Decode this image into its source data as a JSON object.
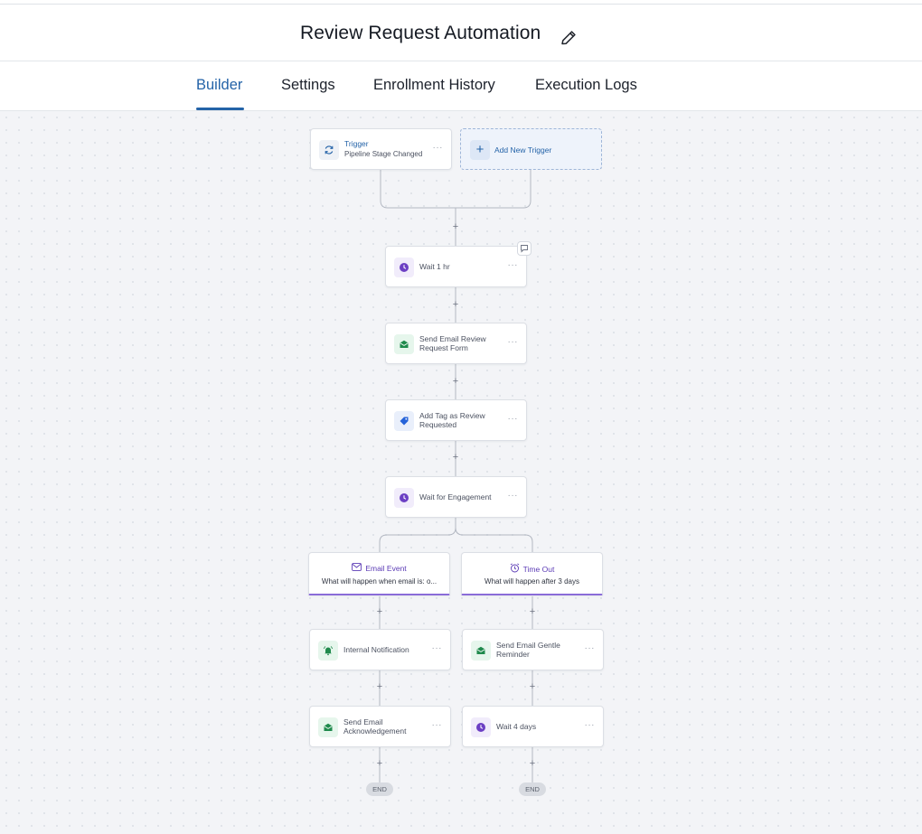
{
  "header": {
    "title": "Review Request Automation"
  },
  "tabs": [
    {
      "label": "Builder",
      "active": true
    },
    {
      "label": "Settings",
      "active": false
    },
    {
      "label": "Enrollment History",
      "active": false
    },
    {
      "label": "Execution Logs",
      "active": false
    }
  ],
  "trigger": {
    "title": "Trigger",
    "subtitle": "Pipeline Stage Changed",
    "icon": "refresh-icon"
  },
  "add_trigger": {
    "label": "Add New Trigger"
  },
  "steps": [
    {
      "label": "Wait 1 hr",
      "icon": "clock-icon"
    },
    {
      "label": "Send Email Review Request Form",
      "icon": "email-icon"
    },
    {
      "label": "Add Tag as Review Requested",
      "icon": "tag-icon"
    },
    {
      "label": "Wait for Engagement",
      "icon": "clock-icon"
    }
  ],
  "branches": [
    {
      "title": "Email Event",
      "subtitle": "What will happen when email is: o...",
      "icon": "envelope-icon"
    },
    {
      "title": "Time Out",
      "subtitle": "What will happen after 3 days",
      "icon": "alarm-icon"
    }
  ],
  "left_steps": [
    {
      "label": "Internal Notification",
      "icon": "bell-icon"
    },
    {
      "label": "Send Email Acknowledgement",
      "icon": "email-icon"
    }
  ],
  "right_steps": [
    {
      "label": "Send Email Gentle Reminder",
      "icon": "email-icon"
    },
    {
      "label": "Wait 4 days",
      "icon": "clock-icon"
    }
  ],
  "end_label": "END",
  "menu_glyph": "···",
  "plus_glyph": "+",
  "colors": {
    "accent": "#2463a8",
    "branch_accent": "#8a6cd8",
    "wait": "#6c3fc4",
    "email": "#1f8a4c",
    "tag": "#2563d9"
  }
}
